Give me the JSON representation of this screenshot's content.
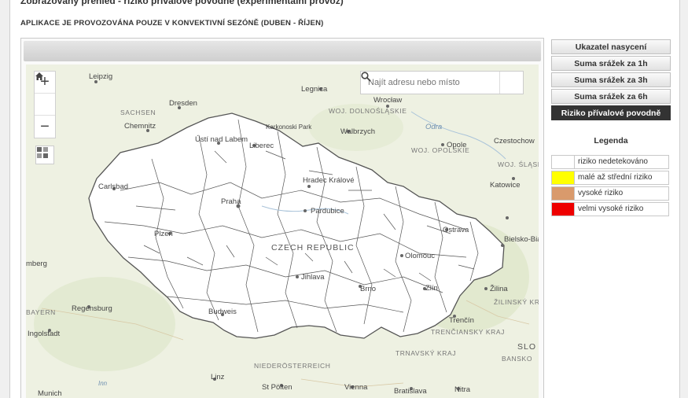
{
  "page": {
    "heading": "Zobrazovaný přenied - riziko přívalové povodně (experimentální provoz)",
    "subheading": "APLIKACE JE PROVOZOVÁNA POUZE V KONVEKTIVNÍ SEZÓNĚ (DUBEN - ŘÍJEN)"
  },
  "map": {
    "search": {
      "placeholder": "Najít adresu nebo místo"
    },
    "zoom_in": "+",
    "zoom_out": "−",
    "country_label": "CZECH REPUBLIC",
    "cities": [
      "Leipzig",
      "Legnica",
      "Wrocław",
      "Dresden",
      "Chemnitz",
      "Ústí nad Labem",
      "Liberec",
      "Karkonoski Park",
      "Walbrzych",
      "Opole",
      "Czestochow",
      "Katowice",
      "Hradec Králové",
      "Praha",
      "Pardubice",
      "Carlsbad",
      "Plzeň",
      "Ostrava",
      "Bielsko-Biała",
      "Olomouc",
      "Jihlava",
      "Brno",
      "Zlín",
      "Žilina",
      "Regensburg",
      "Ingolstadt",
      "Budweis",
      "Trenčín",
      "Linz",
      "St Pölten",
      "Vienna",
      "Bratislava",
      "Nitra",
      "Munich",
      "Odra",
      "Inn",
      "mberg",
      "SLO"
    ],
    "regions": [
      "SACHSEN",
      "WOJ. DOLNOŚLĄSKIE",
      "WOJ. OPOLSKIE",
      "WOJ. ŚLĄSKIE",
      "BAYERN",
      "NIEDERÖSTERREICH",
      "TRNAVSKÝ KRAJ",
      "TRENČIANSKY KRAJ",
      "ŽILINSKÝ KRAJ",
      "BANSKO"
    ]
  },
  "sidebar": {
    "layers": [
      {
        "label": "Ukazatel nasycení",
        "active": false
      },
      {
        "label": "Suma srážek za 1h",
        "active": false
      },
      {
        "label": "Suma srážek za 3h",
        "active": false
      },
      {
        "label": "Suma srážek za 6h",
        "active": false
      },
      {
        "label": "Riziko přívalové povodně",
        "active": true
      }
    ]
  },
  "legend": {
    "title": "Legenda",
    "items": [
      {
        "label": "riziko nedetekováno",
        "color": "#ffffff"
      },
      {
        "label": "malé až střední riziko",
        "color": "#ffff00"
      },
      {
        "label": "vysoké riziko",
        "color": "#d99a6c"
      },
      {
        "label": "velmi vysoké riziko",
        "color": "#ee0000"
      }
    ]
  }
}
